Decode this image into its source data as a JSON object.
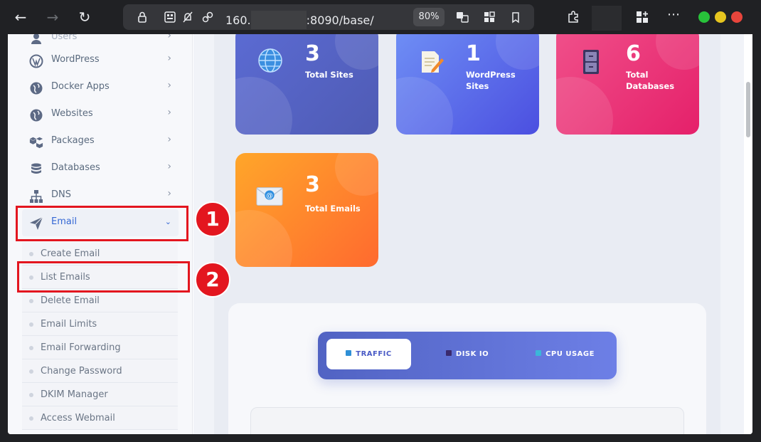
{
  "browser": {
    "url_prefix": "160.",
    "url_suffix": ":8090/base/",
    "zoom": "80%"
  },
  "sidebar": {
    "items": [
      {
        "label": "Users",
        "icon": "users-icon"
      },
      {
        "label": "WordPress",
        "icon": "wordpress-icon"
      },
      {
        "label": "Docker Apps",
        "icon": "globe-icon"
      },
      {
        "label": "Websites",
        "icon": "globe-icon"
      },
      {
        "label": "Packages",
        "icon": "packages-icon"
      },
      {
        "label": "Databases",
        "icon": "database-icon"
      },
      {
        "label": "DNS",
        "icon": "sitemap-icon"
      },
      {
        "label": "Email",
        "icon": "paper-plane-icon"
      }
    ],
    "email_submenu": [
      "Create Email",
      "List Emails",
      "Delete Email",
      "Email Limits",
      "Email Forwarding",
      "Change Password",
      "DKIM Manager",
      "Access Webmail"
    ]
  },
  "stats": [
    {
      "value": "3",
      "label": "Total Sites",
      "icon": "globe-icon"
    },
    {
      "value": "1",
      "label": "WordPress Sites",
      "icon": "document-pencil-icon"
    },
    {
      "value": "6",
      "label": "Total Databases",
      "icon": "file-cabinet-icon"
    },
    {
      "value": "3",
      "label": "Total Emails",
      "icon": "email-envelope-icon"
    }
  ],
  "tabs": [
    {
      "label": "TRAFFIC",
      "icon_color": "#2e8fd6"
    },
    {
      "label": "DISK IO",
      "icon_color": "#3a2a6e"
    },
    {
      "label": "CPU USAGE",
      "icon_color": "#3bb7d9"
    }
  ],
  "annotations": [
    "1",
    "2"
  ],
  "colors": {
    "accent": "#3568d4",
    "annotation_red": "#e3161f"
  }
}
